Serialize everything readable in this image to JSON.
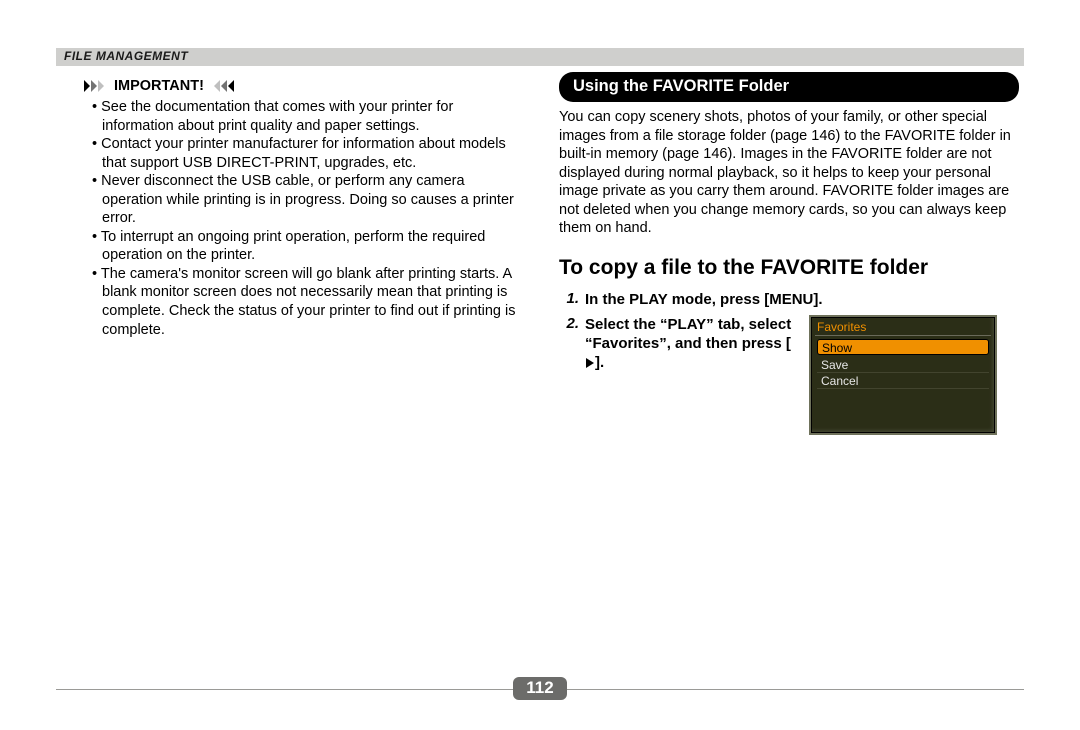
{
  "breadcrumb": "File Management",
  "page_number": "112",
  "important": {
    "heading": "IMPORTANT!",
    "items": [
      "See the documentation that comes with your printer for information about print quality and paper settings.",
      "Contact your printer manufacturer for information about models that support USB DIRECT-PRINT, upgrades, etc.",
      "Never disconnect the USB cable, or perform any camera operation while printing is in progress. Doing so causes a printer error.",
      "To interrupt an ongoing print operation, perform the required operation on the printer.",
      "The camera's monitor screen will go blank after printing starts. A blank monitor screen does not necessarily mean that printing is complete. Check the status of your printer to find out if printing is complete."
    ]
  },
  "right": {
    "section_title": "Using the FAVORITE Folder",
    "section_body": "You can copy scenery shots, photos of your family, or other special images from a file storage folder (page 146) to the FAVORITE folder in built-in memory (page 146). Images in the FAVORITE folder are not displayed during normal playback, so it helps to keep your personal image private as you carry them around. FAVORITE folder images are not deleted when you change memory cards, so you can always keep them on hand.",
    "heading": "To copy a file to the FAVORITE folder",
    "steps": [
      {
        "num": "1.",
        "text": "In the PLAY mode, press [MENU]."
      },
      {
        "num": "2.",
        "text_a": "Select the “PLAY” tab, select “Favorites”, and then press [",
        "text_b": "]."
      }
    ],
    "lcd": {
      "title": "Favorites",
      "items": [
        "Show",
        "Save",
        "Cancel"
      ],
      "selected_index": 0
    }
  }
}
